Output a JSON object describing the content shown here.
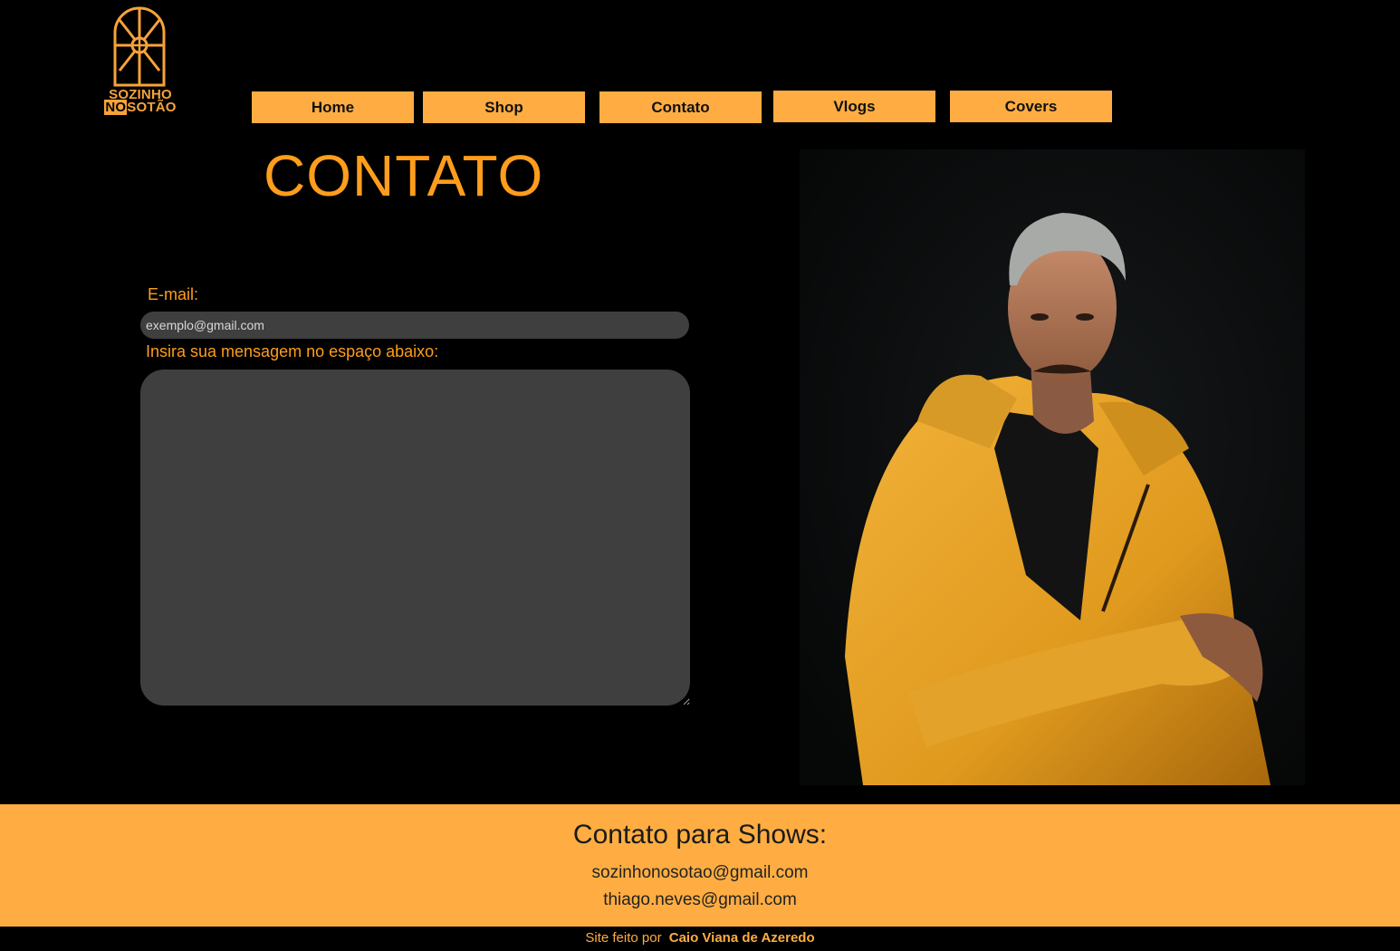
{
  "logo": {
    "line1": "SOZINHO",
    "no": "NO",
    "sotao": "SOTÃO",
    "icon": "arched-window-icon",
    "color": "#f7a33a"
  },
  "nav": {
    "items": [
      {
        "label": "Home"
      },
      {
        "label": "Shop"
      },
      {
        "label": "Contato"
      },
      {
        "label": "Vlogs"
      },
      {
        "label": "Covers"
      }
    ],
    "color": "#ffad42"
  },
  "main": {
    "title": "CONTATO",
    "email_label": "E-mail:",
    "email_placeholder": "exemplo@gmail.com",
    "email_value": "",
    "message_label": "Insira sua mensagem no espaço abaixo:",
    "message_value": "",
    "accent": "#ff9d1c",
    "input_bg": "#3f3f3f"
  },
  "photo": {
    "alt": "Foto do artista com jaqueta amarela"
  },
  "footer": {
    "title": "Contato para Shows:",
    "emails": [
      "sozinhonosotao@gmail.com",
      "thiago.neves@gmail.com"
    ],
    "bg": "#ffad42"
  },
  "credits": {
    "prefix": "Site feito por",
    "author": "Caio Viana de Azeredo"
  }
}
